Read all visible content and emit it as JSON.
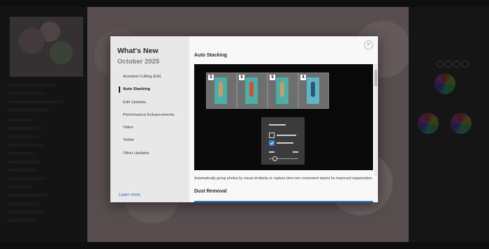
{
  "dialog": {
    "title": "What's New",
    "subtitle": "October 2025",
    "nav_items": [
      {
        "label": "Assisted Culling (EA)",
        "active": false
      },
      {
        "label": "Auto Stacking",
        "active": true
      },
      {
        "label": "Edit Updates",
        "active": false
      },
      {
        "label": "Performance Enhancements",
        "active": false
      },
      {
        "label": "Video",
        "active": false
      },
      {
        "label": "Tether",
        "active": false
      },
      {
        "label": "Other Updates",
        "active": false
      }
    ],
    "learn_more": "Learn more",
    "close_glyph": "✕"
  },
  "content": {
    "section_title": "Auto Stacking",
    "stack_counts": [
      "5",
      "5",
      "5",
      "4"
    ],
    "description": "Automatically group photos by visual similarity or capture time into convenient stacks for improved organization.",
    "next_section_title": "Dust Removal"
  },
  "colors": {
    "accent": "#2b79c8",
    "checkbox_checked": "#2f7fe0",
    "dialog_bg": "#f4f4f4",
    "sidebar_bg": "#e8e8e8"
  }
}
